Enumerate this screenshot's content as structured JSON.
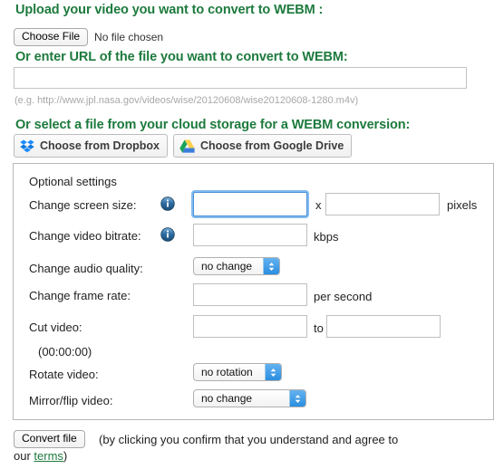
{
  "upload": {
    "heading": "Upload your video you want to convert to WEBM :",
    "choose_file_label": "Choose File",
    "no_file_text": "No file chosen"
  },
  "url": {
    "heading": "Or enter URL of the file you want to convert to WEBM:",
    "value": "",
    "placeholder": "",
    "hint": "(e.g. http://www.jpl.nasa.gov/videos/wise/20120608/wise20120608-1280.m4v)"
  },
  "cloud": {
    "heading": "Or select a file from your cloud storage for a WEBM conversion:",
    "dropbox_label": "Choose from Dropbox",
    "gdrive_label": "Choose from Google Drive",
    "dropbox_icon": "dropbox-icon",
    "gdrive_icon": "google-drive-icon"
  },
  "settings": {
    "title": "Optional settings",
    "info_icon": "info-icon",
    "rows": {
      "screen_size": {
        "label": "Change screen size:",
        "width_value": "",
        "separator": "x",
        "height_value": "",
        "unit": "pixels"
      },
      "video_bitrate": {
        "label": "Change video bitrate:",
        "value": "",
        "unit": "kbps"
      },
      "audio_quality": {
        "label": "Change audio quality:",
        "selected": "no change",
        "options": [
          "no change"
        ]
      },
      "frame_rate": {
        "label": "Change frame rate:",
        "value": "",
        "unit": "per second"
      },
      "cut_video": {
        "label": "Cut video:",
        "from_value": "",
        "separator": "to",
        "to_value": "",
        "hint": "(00:00:00)"
      },
      "rotate_video": {
        "label": "Rotate video:",
        "selected": "no rotation",
        "options": [
          "no rotation"
        ]
      },
      "mirror_flip": {
        "label": "Mirror/flip video:",
        "selected": "no change",
        "options": [
          "no change"
        ]
      }
    }
  },
  "footer": {
    "convert_label": "Convert file",
    "note_line1": "(by clicking you confirm that you understand and agree to",
    "note_line2_prefix": "our ",
    "terms_label": "terms",
    "note_line2_suffix": ")"
  },
  "colors": {
    "heading_green": "#1d7a3d",
    "link_green": "#1d7a3d",
    "focus_blue": "#4a90d9",
    "select_blue": "#2a8ee0",
    "hint_gray": "#a8a8a8"
  }
}
